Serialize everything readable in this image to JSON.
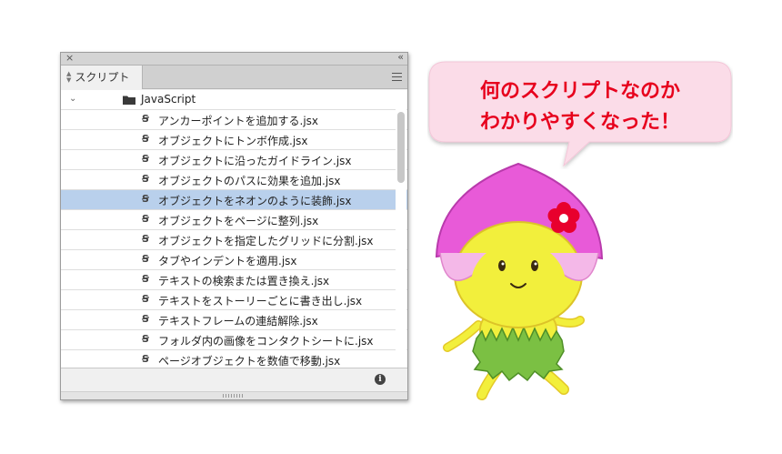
{
  "panel": {
    "title_close": "×",
    "title_collapse": "‹‹",
    "tab": {
      "label": "スクリプト"
    },
    "folder": {
      "label": "JavaScript"
    },
    "scripts": [
      {
        "label": "アンカーポイントを追加する.jsx"
      },
      {
        "label": "オブジェクトにトンボ作成.jsx"
      },
      {
        "label": "オブジェクトに沿ったガイドライン.jsx"
      },
      {
        "label": "オブジェクトのパスに効果を追加.jsx"
      },
      {
        "label": "オブジェクトをネオンのように装飾.jsx"
      },
      {
        "label": "オブジェクトをページに整列.jsx"
      },
      {
        "label": "オブジェクトを指定したグリッドに分割.jsx"
      },
      {
        "label": "タブやインデントを適用.jsx"
      },
      {
        "label": "テキストの検索または置き換え.jsx"
      },
      {
        "label": "テキストをストーリーごとに書き出し.jsx"
      },
      {
        "label": "テキストフレームの連結解除.jsx"
      },
      {
        "label": "フォルダ内の画像をコンタクトシートに.jsx"
      },
      {
        "label": "ページオブジェクトを数値で移動.jsx"
      }
    ],
    "selected_index": 4,
    "script_icon_glyph": "Ꞩ",
    "info_glyph": "i"
  },
  "bubble": {
    "line1": "何のスクリプトなのか",
    "line2": "わかりやすくなった！"
  },
  "colors": {
    "selection": "#b9d0ec",
    "bubble_fill": "#fbdce8",
    "bubble_text": "#e7001d",
    "character_body": "#f2ef3c",
    "character_hat": "#e85ad8",
    "character_skirt": "#7bc043",
    "flower": "#e8002d"
  }
}
